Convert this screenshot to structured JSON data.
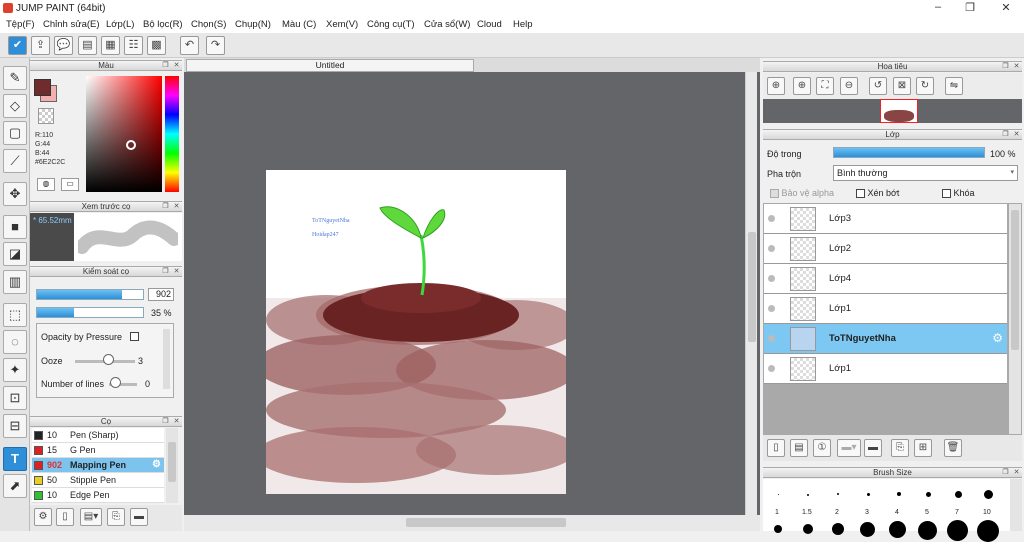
{
  "window": {
    "title": "JUMP PAINT (64bit)",
    "minimize": "–",
    "maximize": "❐",
    "close": "✕"
  },
  "menu": [
    "Tệp(F)",
    "Chỉnh sửa(E)",
    "Lớp(L)",
    "Bộ lọc(R)",
    "Chọn(S)",
    "Chụp(N)",
    "Màu (C)",
    "Xem(V)",
    "Công cụ(T)",
    "Cửa sổ(W)",
    "Cloud",
    "Help"
  ],
  "color_panel": {
    "title": "Màu",
    "r": "R:110",
    "g": "G:44",
    "b": "B:44",
    "hex": "#6E2C2C",
    "fg": "#6e2c2c",
    "bg": "#f4b0b0"
  },
  "brush_preview": {
    "title": "Xem trước cọ",
    "size": "65.52mm"
  },
  "brush_control": {
    "title": "Kiểm soát cọ",
    "size_value": "902",
    "opacity_value": "35 %",
    "size_fill": 0.8,
    "opacity_fill": 0.35,
    "opacity_pressure": "Opacity by Pressure",
    "ooze_label": "Ooze",
    "ooze_value": "3",
    "lines_label": "Number of lines",
    "lines_value": "0"
  },
  "brush_list": {
    "title": "Cọ",
    "items": [
      {
        "size": "10",
        "name": "Pen (Sharp)",
        "color": "#222222"
      },
      {
        "size": "15",
        "name": "G Pen",
        "color": "#e02020"
      },
      {
        "size": "902",
        "name": "Mapping Pen",
        "color": "#e02020",
        "selected": true
      },
      {
        "size": "50",
        "name": "Stipple Pen",
        "color": "#e8d020"
      },
      {
        "size": "10",
        "name": "Edge Pen",
        "color": "#30c030"
      }
    ]
  },
  "document": {
    "tab": "Untitled",
    "text_line1": "ToTNguyetNha",
    "text_line2": "Hoidap247"
  },
  "navigator": {
    "title": "Hoa tiêu"
  },
  "layers": {
    "title": "Lớp",
    "opacity_label": "Độ trong",
    "opacity_value": "100 %",
    "blend_label": "Pha trộn",
    "blend_value": "Bình thường",
    "protect_alpha": "Bảo vệ alpha",
    "clipping": "Xén bớt",
    "lock": "Khóa",
    "items": [
      {
        "name": "Lớp3"
      },
      {
        "name": "Lớp2"
      },
      {
        "name": "Lớp4"
      },
      {
        "name": "Lớp1"
      },
      {
        "name": "ToTNguyetNha",
        "selected": true
      },
      {
        "name": "Lớp1"
      }
    ]
  },
  "brush_size": {
    "title": "Brush Size",
    "labels": [
      "1",
      "1.5",
      "2",
      "3",
      "4",
      "5",
      "7",
      "10"
    ]
  }
}
